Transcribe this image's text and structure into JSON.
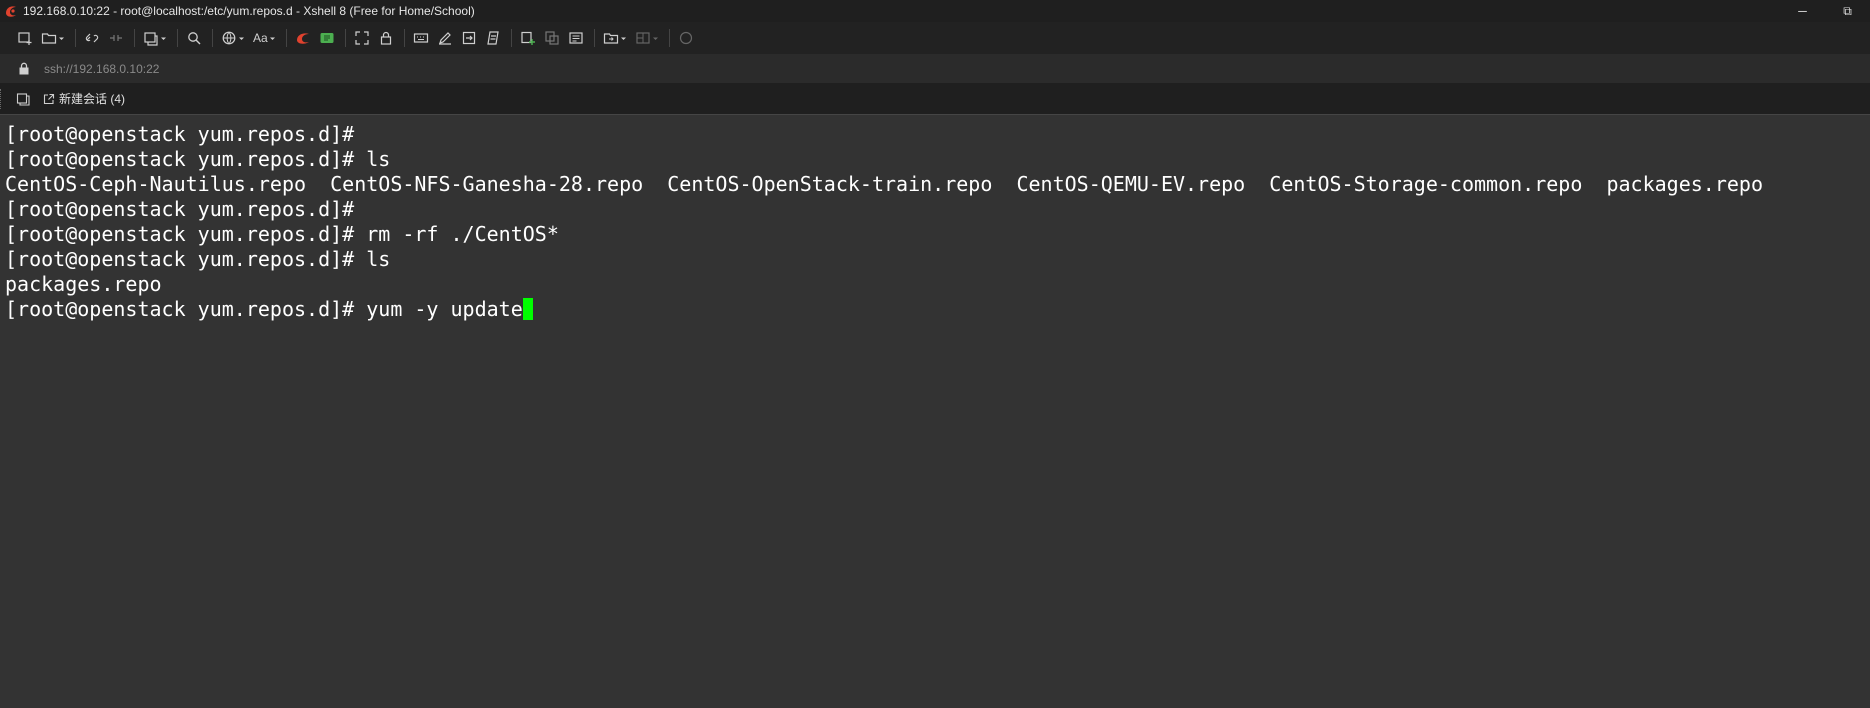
{
  "window": {
    "title": "192.168.0.10:22 - root@localhost:/etc/yum.repos.d - Xshell 8 (Free for Home/School)",
    "minimize": "─",
    "restore": "⧉"
  },
  "toolbar": {
    "font_label": "Aa",
    "icons": [
      "new-session-icon",
      "open-folder-icon",
      "connect-icon",
      "disconnect-icon",
      "new-tab-icon",
      "search-icon",
      "globe-icon",
      "font-icon",
      "xshell-icon",
      "xftp-icon",
      "fullscreen-icon",
      "lock-icon",
      "keyboard-icon",
      "compose-icon",
      "transfer-icon",
      "script-icon",
      "new-file-icon",
      "copy-icon",
      "notes-icon",
      "folder-arrow-icon",
      "layout-icon",
      "chat-icon"
    ]
  },
  "address": {
    "url": "ssh://192.168.0.10:22"
  },
  "tabs": [
    {
      "label": "新建会话 (4)"
    }
  ],
  "terminal": {
    "lines": [
      "[root@openstack yum.repos.d]#",
      "[root@openstack yum.repos.d]# ls",
      "CentOS-Ceph-Nautilus.repo  CentOS-NFS-Ganesha-28.repo  CentOS-OpenStack-train.repo  CentOS-QEMU-EV.repo  CentOS-Storage-common.repo  packages.repo",
      "[root@openstack yum.repos.d]#",
      "[root@openstack yum.repos.d]# rm -rf ./CentOS*",
      "[root@openstack yum.repos.d]# ls",
      "packages.repo",
      "[root@openstack yum.repos.d]# yum -y update"
    ],
    "cursor_color": "#00ff00",
    "background": "#333333"
  }
}
